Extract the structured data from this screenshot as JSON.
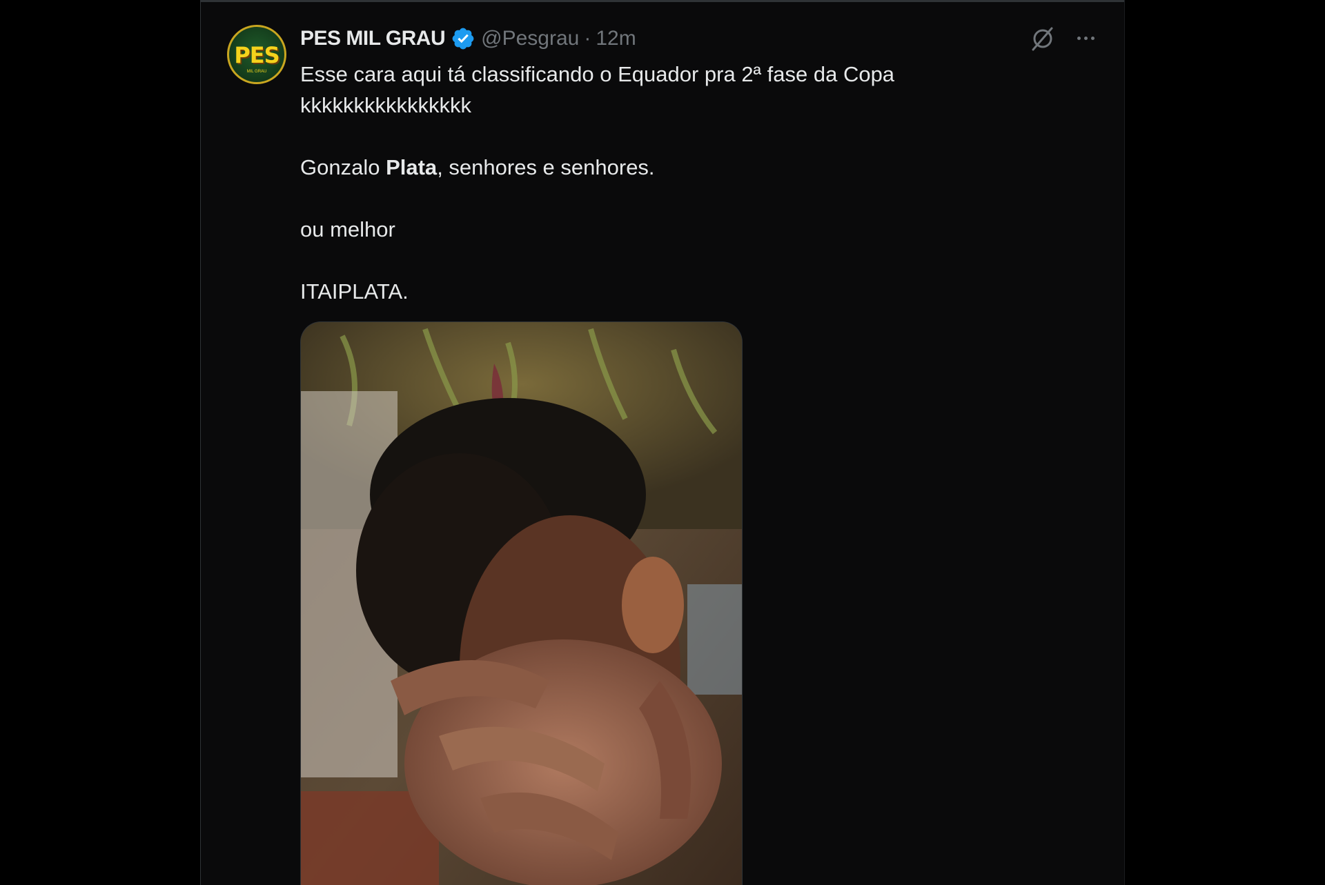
{
  "tweet": {
    "display_name": "PES MIL GRAU",
    "handle": "@Pesgrau",
    "separator": "·",
    "timestamp": "12m",
    "avatar_text": "PES",
    "avatar_subtext": "MIL GRAU",
    "text": {
      "line1": "Esse cara aqui tá classificando o Equador pra 2ª fase da Copa",
      "line2": "kkkkkkkkkkkkkkkk",
      "para2_pre": "Gonzalo ",
      "para2_bold": "Plata",
      "para2_post": ", senhores e senhores.",
      "para3": "ou melhor",
      "para4": "ITAIPLATA."
    },
    "icons": {
      "verified": "verified-badge-icon",
      "grok": "grok-icon",
      "more": "more-options-icon"
    }
  },
  "colors": {
    "background": "#000000",
    "column": "#0a0a0b",
    "text": "#e7e9ea",
    "secondary_text": "#71767b",
    "verified_blue": "#1d9bf0",
    "border": "#2f3336"
  }
}
